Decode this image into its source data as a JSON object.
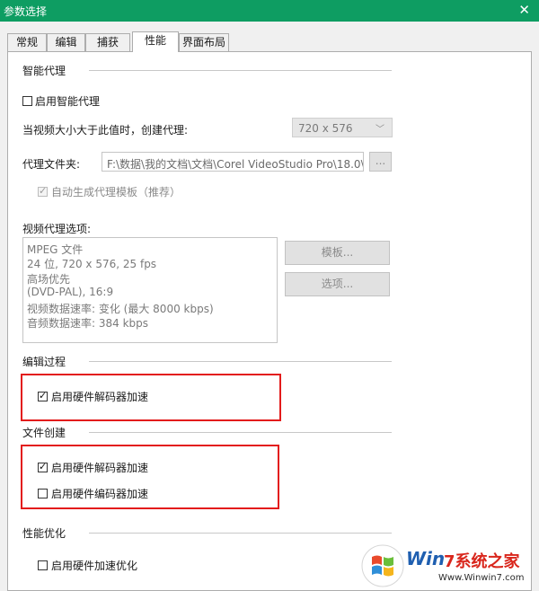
{
  "window": {
    "title": "参数选择",
    "close_glyph": "✕"
  },
  "tabs": [
    {
      "label": "常规",
      "active": false
    },
    {
      "label": "编辑",
      "active": false
    },
    {
      "label": "捕获",
      "active": false
    },
    {
      "label": "性能",
      "active": true
    },
    {
      "label": "界面布局",
      "active": false
    }
  ],
  "smart_proxy": {
    "group_title": "智能代理",
    "enable_label": "启用智能代理",
    "enable_checked": false,
    "threshold_label": "当视频大小大于此值时，创建代理:",
    "threshold_value": "720 x 576",
    "folder_label": "代理文件夹:",
    "folder_value": "F:\\数据\\我的文档\\文档\\Corel VideoStudio Pro\\18.0\\",
    "browse_label": "...",
    "auto_template_label": "自动生成代理模板（推荐）",
    "auto_template_checked": true
  },
  "video_proxy": {
    "label": "视频代理选项:",
    "lines": [
      "MPEG 文件",
      "24 位, 720 x 576, 25 fps",
      "高场优先",
      "(DVD-PAL),  16:9",
      "视频数据速率: 变化 (最大  8000 kbps)",
      "音频数据速率: 384 kbps"
    ],
    "template_button": "模板...",
    "options_button": "选项..."
  },
  "edit_process": {
    "group_title": "编辑过程",
    "hw_decode_label": "启用硬件解码器加速",
    "hw_decode_checked": true
  },
  "file_creation": {
    "group_title": "文件创建",
    "hw_decode_label": "启用硬件解码器加速",
    "hw_decode_checked": true,
    "hw_encode_label": "启用硬件编码器加速",
    "hw_encode_checked": false
  },
  "perf_opt": {
    "group_title": "性能优化",
    "hw_accel_opt_label": "启用硬件加速优化",
    "hw_accel_opt_checked": false
  },
  "watermark": {
    "text_part1": "Win",
    "text_part2": "7系统之家",
    "url": "Www.Winwin7.com"
  },
  "colors": {
    "titlebar": "#0e9d62",
    "highlight": "#e31c1c",
    "watermark_blue": "#1f5fb0",
    "watermark_red": "#d9261c"
  }
}
